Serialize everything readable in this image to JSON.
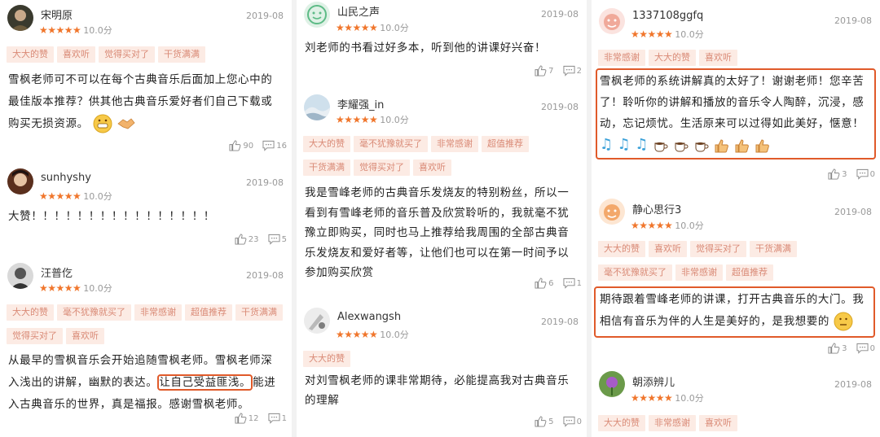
{
  "stars": "★★★★★",
  "col1": {
    "r1": {
      "user": "宋明原",
      "date": "2019-08",
      "score": "10.0分",
      "tags": [
        "大大的赞",
        "喜欢听",
        "觉得买对了",
        "干货满满"
      ],
      "text": "雪枫老师可不可以在每个古典音乐后面加上您心中的最佳版本推荐？供其他古典音乐爱好者们自己下载或购买无损资源。",
      "likes": "90",
      "comments": "16"
    },
    "r2": {
      "user": "sunhyshy",
      "date": "2019-08",
      "score": "10.0分",
      "text": "大赞！！！！！！！！！！！！！！！！",
      "likes": "23",
      "comments": "5"
    },
    "r3": {
      "user": "汪普仡",
      "date": "2019-08",
      "score": "10.0分",
      "tags": [
        "大大的赞",
        "毫不犹豫就买了",
        "非常感谢",
        "超值推荐",
        "干货满满",
        "觉得买对了",
        "喜欢听"
      ],
      "text_a": "从最早的雪枫音乐会开始追随雪枫老师。雪枫老师深入浅出的讲解，幽默的表达。",
      "text_hl": "让自己受益匪浅。",
      "text_b": "能进入古典音乐的世界，真是福报。感谢雪枫老师。",
      "likes": "12",
      "comments": "1"
    }
  },
  "col2": {
    "r1": {
      "user": "山民之声",
      "date": "2019-08",
      "score": "10.0分",
      "text": "刘老师的书看过好多本，听到他的讲课好兴奋！",
      "likes": "7",
      "comments": "2"
    },
    "r2": {
      "user": "李耀强_in",
      "date": "2019-08",
      "score": "10.0分",
      "tags": [
        "大大的赞",
        "毫不犹豫就买了",
        "非常感谢",
        "超值推荐",
        "干货满满",
        "觉得买对了",
        "喜欢听"
      ],
      "text": "我是雪峰老师的古典音乐发烧友的特别粉丝，所以一看到有雪峰老师的音乐普及欣赏聆听的，我就毫不犹豫立即购买，同时也马上推荐给我周围的全部古典音乐发烧友和爱好者等，让他们也可以在第一时间予以参加购买欣赏",
      "likes": "6",
      "comments": "1"
    },
    "r3": {
      "user": "Alexwangsh",
      "date": "2019-08",
      "score": "10.0分",
      "tags": [
        "大大的赞"
      ],
      "text": "对刘雪枫老师的课非常期待，必能提高我对古典音乐的理解",
      "likes": "5",
      "comments": "0"
    }
  },
  "col3": {
    "r1": {
      "user": "1337108ggfq",
      "date": "2019-08",
      "score": "10.0分",
      "tags": [
        "非常感谢",
        "大大的赞",
        "喜欢听"
      ],
      "text": "雪枫老师的系统讲解真的太好了！谢谢老师！您辛苦了！聆听你的讲解和播放的音乐令人陶醉，沉浸，感动，忘记烦忧。生活原来可以过得如此美好，惬意！",
      "likes": "3",
      "comments": "0"
    },
    "r2": {
      "user": "静心思行3",
      "date": "2019-08",
      "score": "10.0分",
      "tags": [
        "大大的赞",
        "喜欢听",
        "觉得买对了",
        "干货满满",
        "毫不犹豫就买了",
        "非常感谢",
        "超值推荐"
      ],
      "text": "期待跟着雪峰老师的讲课，打开古典音乐的大门。我相信有音乐为伴的人生是美好的，是我想要的",
      "likes": "3",
      "comments": "0"
    },
    "r3": {
      "user": "朝添辨儿",
      "date": "2019-08",
      "score": "10.0分",
      "tags": [
        "大大的赞",
        "非常感谢",
        "喜欢听"
      ]
    }
  }
}
